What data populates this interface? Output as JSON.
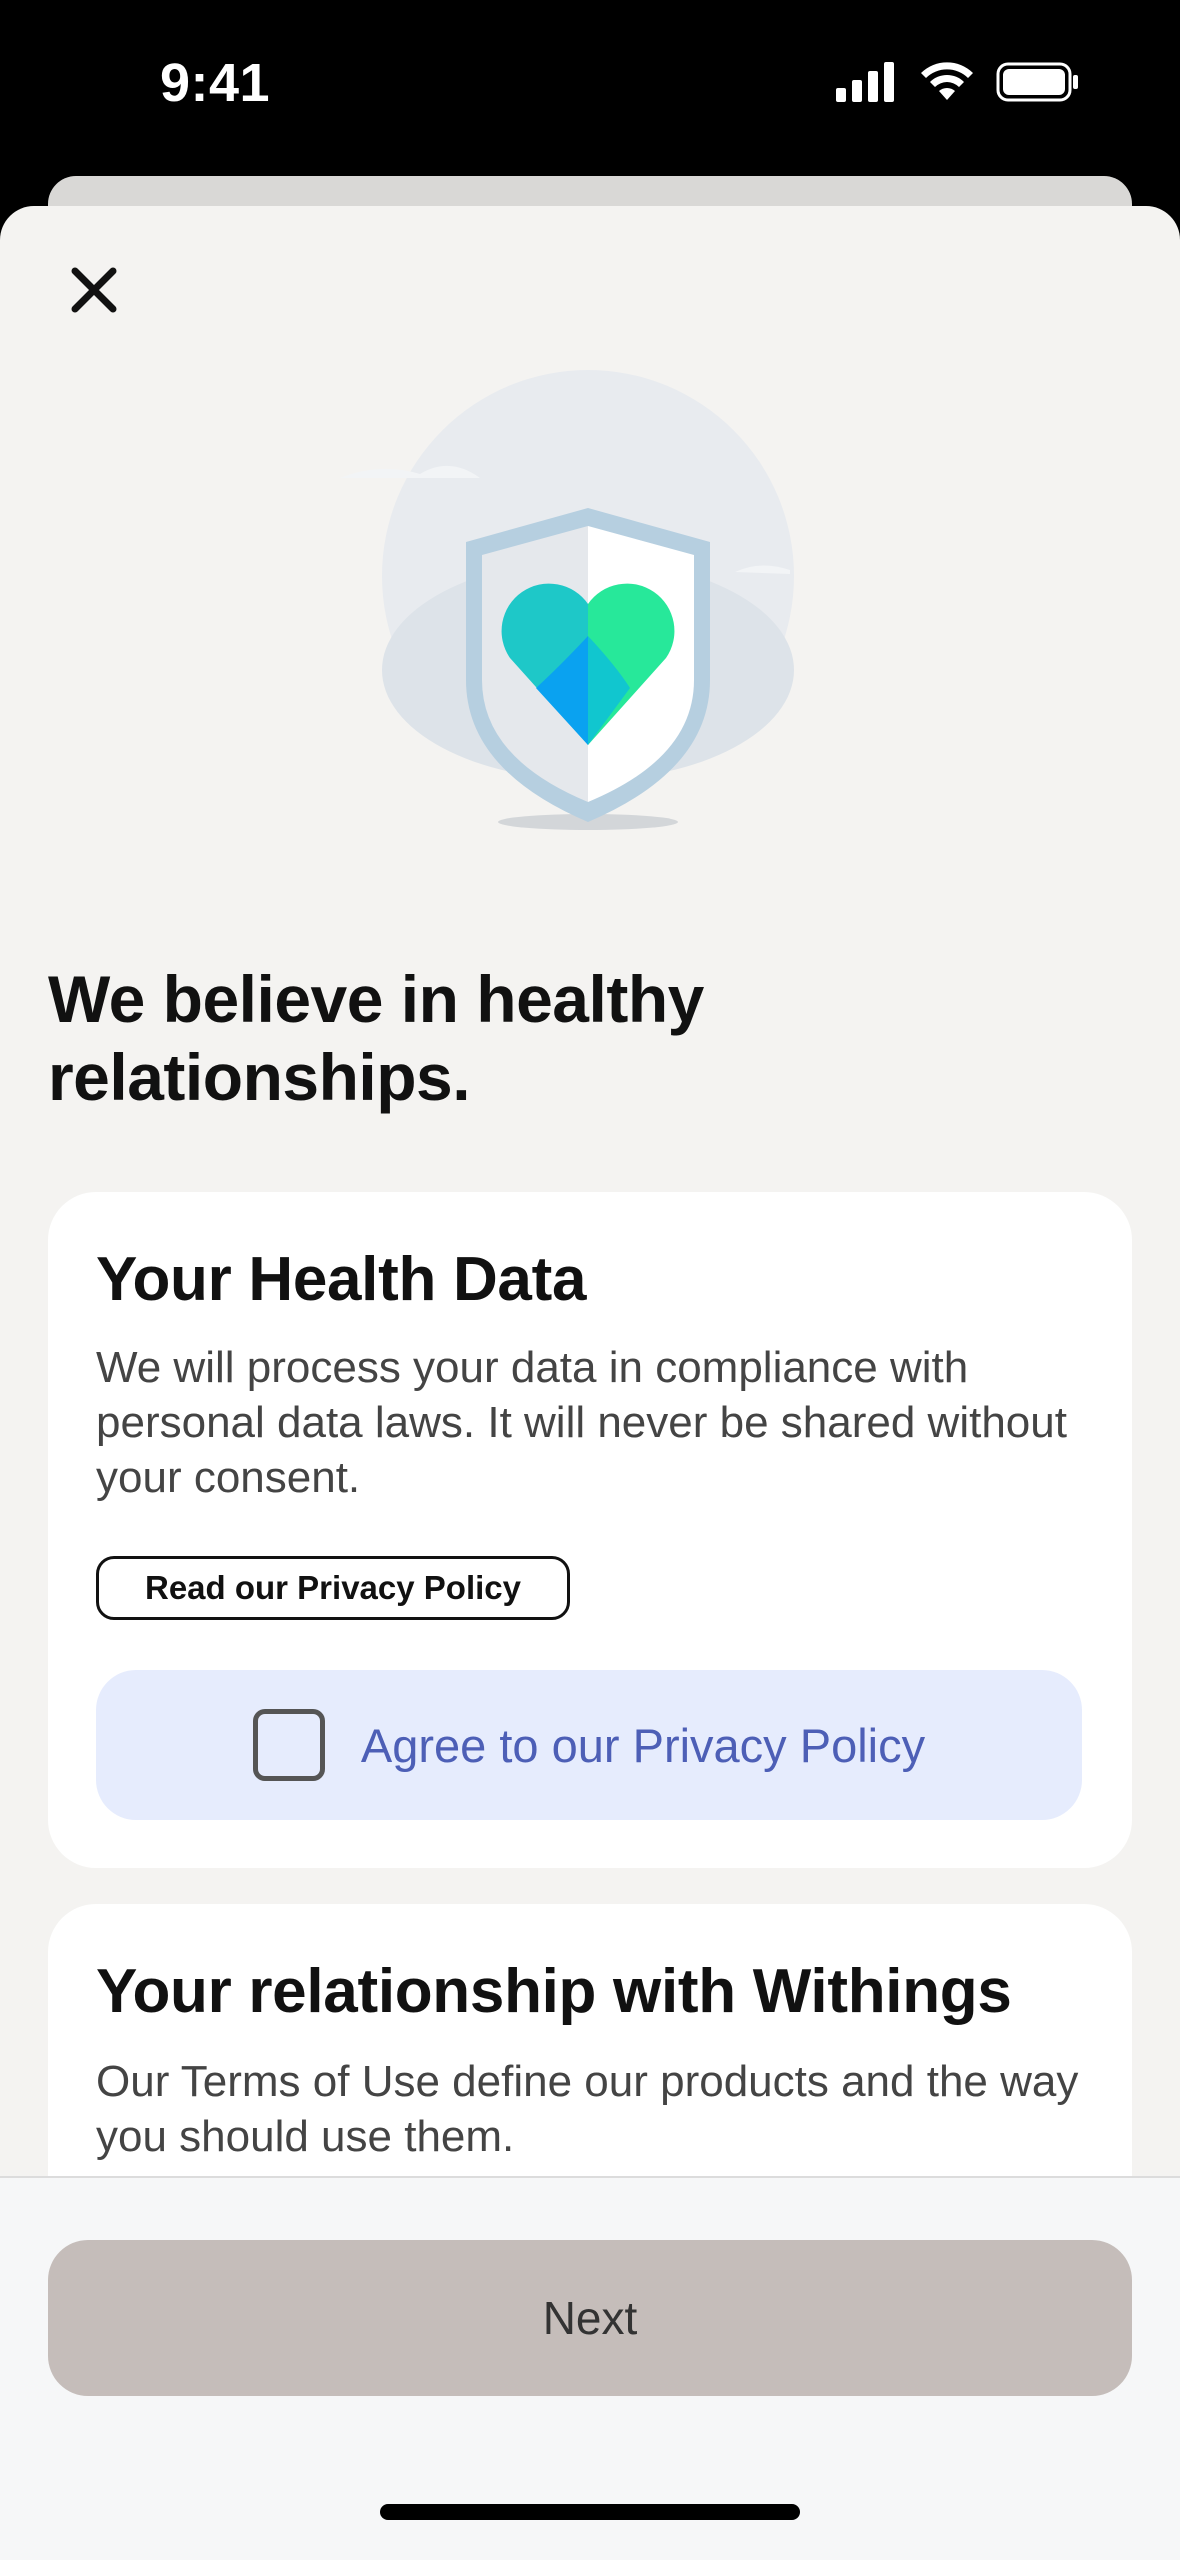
{
  "status_bar": {
    "time": "9:41",
    "icons": [
      "signal-icon",
      "wifi-icon",
      "battery-icon"
    ]
  },
  "header": {
    "close_icon": "close-icon"
  },
  "headline": "We believe in healthy relationships.",
  "health_card": {
    "title": "Your Health Data",
    "body": "We will process your data in compliance with personal data laws. It will never be shared without your consent.",
    "link_label": "Read our Privacy Policy",
    "agree_label": "Agree to our Privacy Policy",
    "agree_checked": false
  },
  "relationship_card": {
    "title": "Your relationship with Withings",
    "body": "Our Terms of Use define our products and the way you should use them."
  },
  "footer": {
    "next_label": "Next"
  },
  "colors": {
    "accent_link": "#4d5fb6",
    "agree_bg": "#e6ecfd",
    "next_bg": "#c5bdba",
    "heart_teal": "#1ec8c8",
    "heart_green": "#27e89a",
    "heart_blue": "#0aa2f0"
  }
}
